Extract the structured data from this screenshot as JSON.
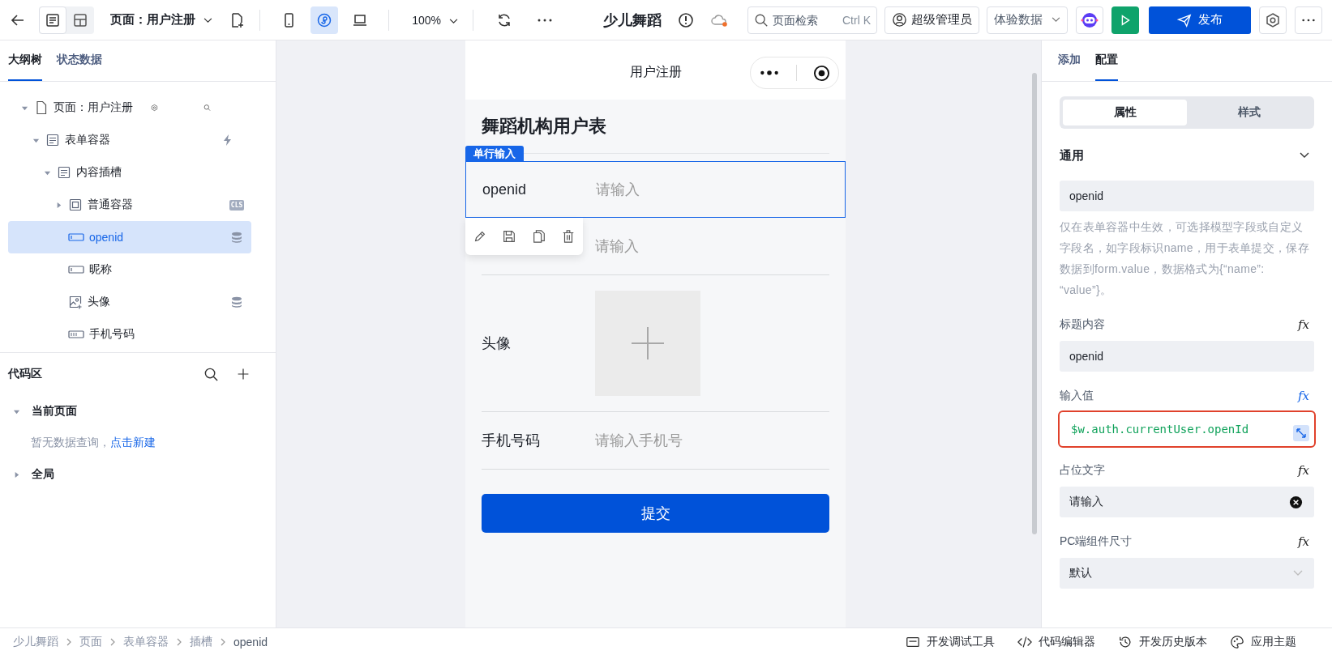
{
  "topbar": {
    "views": [
      {
        "kind": "outline",
        "selected": true
      },
      {
        "kind": "layout",
        "selected": false
      }
    ],
    "page_selector": "页面：用户注册",
    "devices": [
      {
        "kind": "phone",
        "selected": false
      },
      {
        "kind": "miniprogram",
        "selected": true
      },
      {
        "kind": "laptop",
        "selected": false
      }
    ],
    "zoom": "100%",
    "app_title": "少儿舞蹈",
    "search": {
      "placeholder": "页面检索",
      "shortcut": "Ctrl K"
    },
    "user": "超级管理员",
    "environment": "体验数据",
    "publish": "发布"
  },
  "outline": {
    "tabs": [
      {
        "label": "大纲树",
        "selected": true
      },
      {
        "label": "状态数据",
        "selected": false
      }
    ],
    "tree": [
      {
        "label": "页面：用户注册",
        "kind": "page",
        "expanded": true,
        "selected": false,
        "children": [
          {
            "label": "表单容器",
            "kind": "form",
            "expanded": true,
            "selected": false,
            "badge": {
              "kind": "action"
            },
            "children": [
              {
                "label": "内容插槽",
                "kind": "form",
                "expanded": true,
                "selected": false,
                "children": [
                  {
                    "label": "普通容器",
                    "kind": "container",
                    "expanded": false,
                    "selected": false,
                    "badge": {
                      "kind": "class",
                      "text": "CLS"
                    }
                  },
                  {
                    "label": "openid",
                    "kind": "input",
                    "selected": true,
                    "badge": {
                      "kind": "data"
                    }
                  },
                  {
                    "label": "昵称",
                    "kind": "input",
                    "selected": false
                  },
                  {
                    "label": "头像",
                    "kind": "image",
                    "selected": false,
                    "badge": {
                      "kind": "data"
                    }
                  },
                  {
                    "label": "手机号码",
                    "kind": "number",
                    "selected": false
                  }
                ]
              }
            ]
          }
        ]
      }
    ]
  },
  "code_area": {
    "title": "代码区",
    "sections": [
      {
        "label": "当前页面",
        "expanded": true,
        "empty_text": "暂无数据查询，",
        "link": "点击新建"
      },
      {
        "label": "全局",
        "expanded": false
      }
    ]
  },
  "preview": {
    "nav_title": "用户注册",
    "form_title": "舞蹈机构用户表",
    "selection_tag": "单行输入",
    "fields": [
      {
        "kind": "text",
        "label": "openid",
        "placeholder": "请输入",
        "selected": true
      },
      {
        "kind": "text",
        "placeholder": "请输入",
        "selected": false
      },
      {
        "kind": "image",
        "label": "头像",
        "selected": false
      },
      {
        "kind": "text",
        "label": "手机号码",
        "placeholder": "请输入手机号",
        "selected": false
      }
    ],
    "submit": "提交"
  },
  "config": {
    "tabs": [
      {
        "label": "添加",
        "selected": false
      },
      {
        "label": "配置",
        "selected": true
      }
    ],
    "segments": [
      {
        "label": "属性",
        "selected": true
      },
      {
        "label": "样式",
        "selected": false
      }
    ],
    "section": {
      "title": "通用",
      "expanded": true
    },
    "name_value": "openid",
    "help": "仅在表单容器中生效，可选择模型字段或自定义字段名，如字段标识name，用于表单提交，保存数据到form.value，数据格式为{“name”: “value”}。",
    "props": [
      {
        "label": "标题内容",
        "kind": "text",
        "value": "openid",
        "formula": "fx",
        "bound": false,
        "highlighted": false
      },
      {
        "label": "输入值",
        "kind": "code",
        "value": "$w.auth.currentUser.openId",
        "formula": "fx",
        "bound": true,
        "highlighted": true
      },
      {
        "label": "占位文字",
        "kind": "clearable",
        "value": "请输入",
        "formula": "fx",
        "bound": false,
        "highlighted": false
      },
      {
        "label": "PC端组件尺寸",
        "kind": "select",
        "value": "默认",
        "formula": "fx",
        "bound": false,
        "highlighted": false
      }
    ]
  },
  "status_bar": {
    "breadcrumbs": [
      "少儿舞蹈",
      "页面",
      "表单容器",
      "插槽",
      "openid"
    ],
    "tools": [
      {
        "kind": "debug",
        "label": "开发调试工具"
      },
      {
        "kind": "code",
        "label": "代码编辑器"
      },
      {
        "kind": "history",
        "label": "开发历史版本"
      },
      {
        "kind": "theme",
        "label": "应用主题"
      }
    ]
  }
}
